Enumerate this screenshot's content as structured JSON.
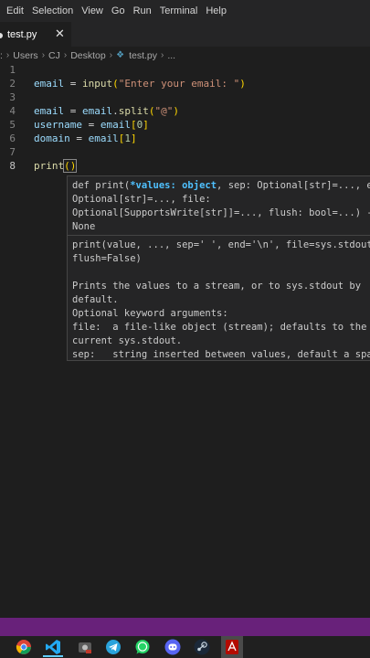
{
  "menu": [
    "Edit",
    "Selection",
    "View",
    "Go",
    "Run",
    "Terminal",
    "Help"
  ],
  "tab": {
    "label": "test.py",
    "close_glyph": "✕"
  },
  "breadcrumb": {
    "parts": [
      ":",
      "Users",
      "CJ",
      "Desktop",
      "test.py",
      "..."
    ],
    "separator": "›"
  },
  "editor": {
    "line_numbers": [
      "1",
      "2",
      "3",
      "4",
      "5",
      "6",
      "7",
      "8"
    ],
    "line2": {
      "var": "email",
      "op": " = ",
      "fn": "input",
      "open": "(",
      "str": "\"Enter your email: \"",
      "close": ")"
    },
    "line4": {
      "var": "email",
      "op": " = ",
      "var2": "email",
      "dot": ".",
      "fn": "split",
      "open": "(",
      "str": "\"@\"",
      "close": ")"
    },
    "line5": {
      "var": "username",
      "op": " = ",
      "var2": "email",
      "open": "[",
      "num": "0",
      "close": "]"
    },
    "line6": {
      "var": "domain",
      "op": " = ",
      "var2": "email",
      "open": "[",
      "num": "1",
      "close": "]"
    },
    "line8": {
      "fn": "print",
      "parens": "()"
    }
  },
  "hover": {
    "sig_prefix": "def print(",
    "sig_active": "*values: object",
    "sig_rest": ", sep: Optional[str]=..., end:\nOptional[str]=..., file:\nOptional[SupportsWrite[str]]=..., flush: bool=...) ->\nNone",
    "doc": "print(value, ..., sep=' ', end='\\n', file=sys.stdout,\nflush=False)\n\nPrints the values to a stream, or to sys.stdout by\ndefault.\nOptional keyword arguments:\nfile:  a file-like object (stream); defaults to the\ncurrent sys.stdout.\nsep:   string inserted between values, default a space."
  },
  "colors": {
    "statusbar": "#68217a",
    "accent": "#60cdff"
  },
  "taskbar_icons": [
    "chrome-icon",
    "vscode-icon",
    "app-icon",
    "telegram-icon",
    "whatsapp-icon",
    "discord-icon",
    "steam-icon",
    "pdf-icon"
  ]
}
